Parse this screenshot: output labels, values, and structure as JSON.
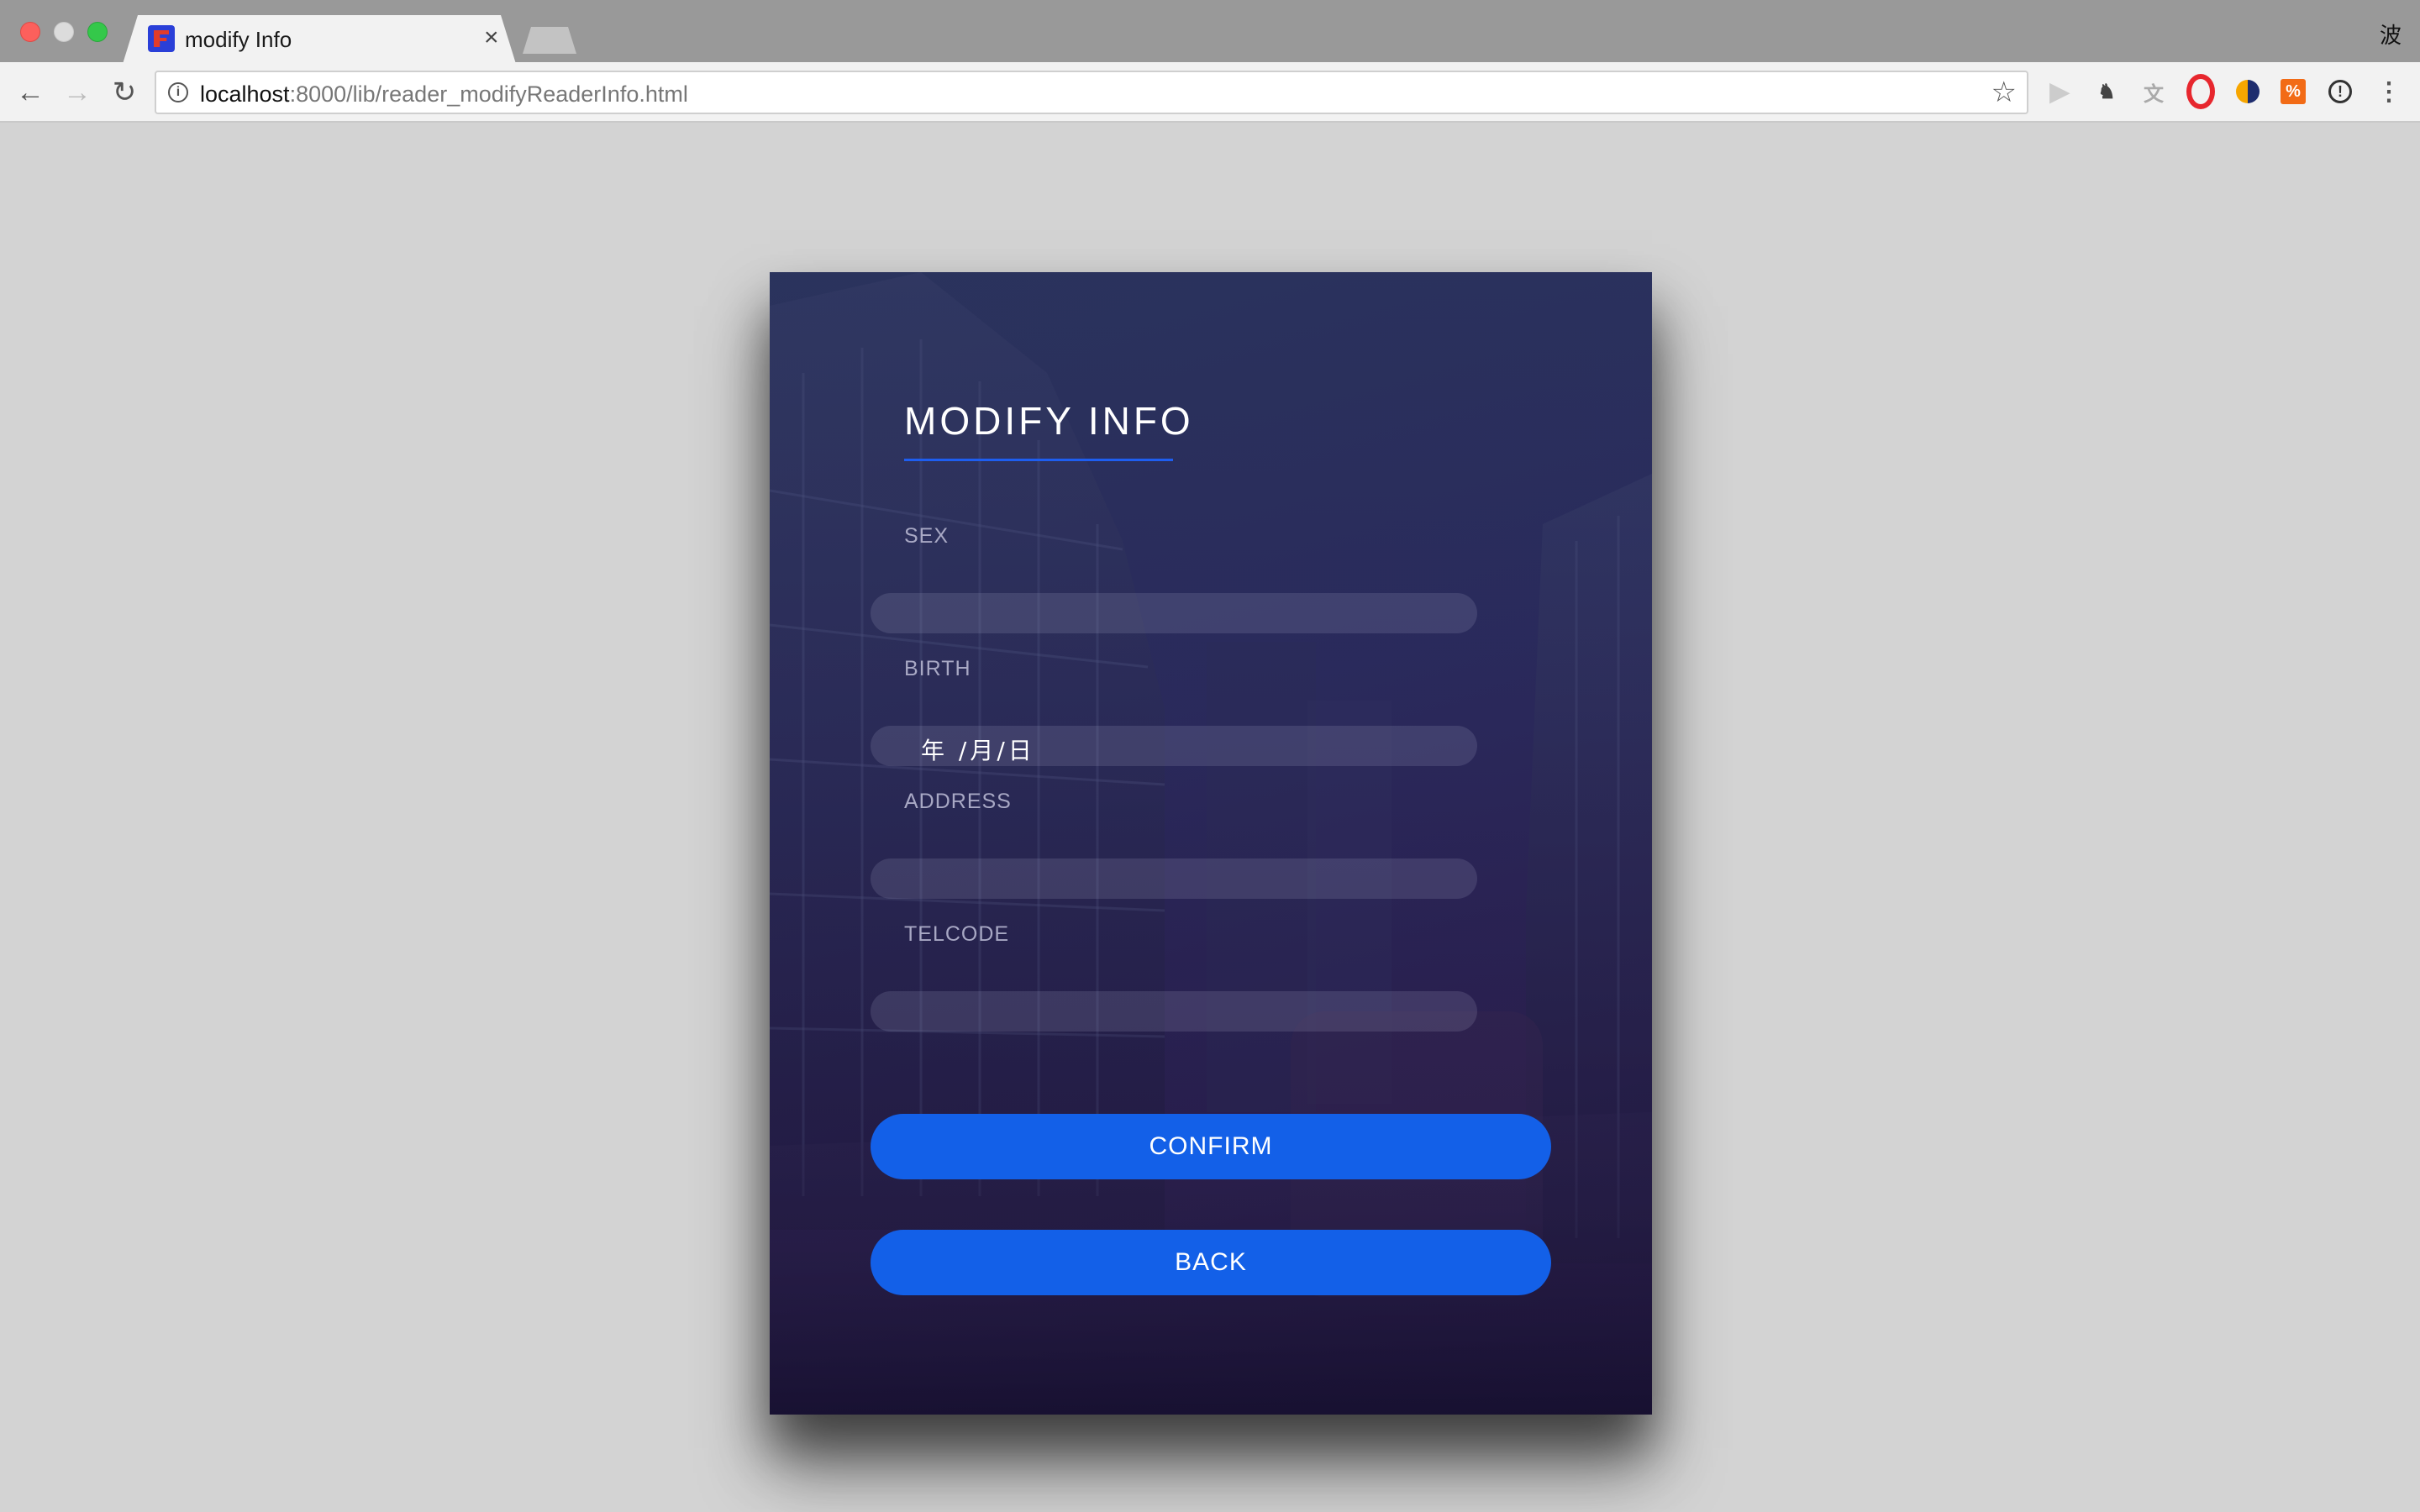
{
  "browser": {
    "tab_title": "modify Info",
    "tab_close": "×",
    "ime_indicator": "波",
    "url_host": "localhost",
    "url_path": ":8000/lib/reader_modifyReaderInfo.html",
    "nav": {
      "back": "←",
      "forward": "→",
      "reload": "↻"
    },
    "bookmark_star": "☆",
    "extensions": [
      "play-icon",
      "evernote-icon",
      "translate-icon",
      "opera-icon",
      "half-circle-icon",
      "orange-extension-icon",
      "password-icon",
      "menu-icon"
    ],
    "menu_glyph": "⋮"
  },
  "form": {
    "title": "MODIFY INFO",
    "fields": [
      {
        "label": "SEX",
        "value": ""
      },
      {
        "label": "BIRTH",
        "value": "年 /月/日"
      },
      {
        "label": "ADDRESS",
        "value": ""
      },
      {
        "label": "TELCODE",
        "value": ""
      }
    ],
    "confirm_label": "CONFIRM",
    "back_label": "BACK"
  },
  "colors": {
    "accent": "#1360e8",
    "underline": "#1e5ef0",
    "page_bg": "#d3d3d3",
    "card_bg_top": "#2c3359",
    "card_bg_bottom": "#20123a"
  }
}
